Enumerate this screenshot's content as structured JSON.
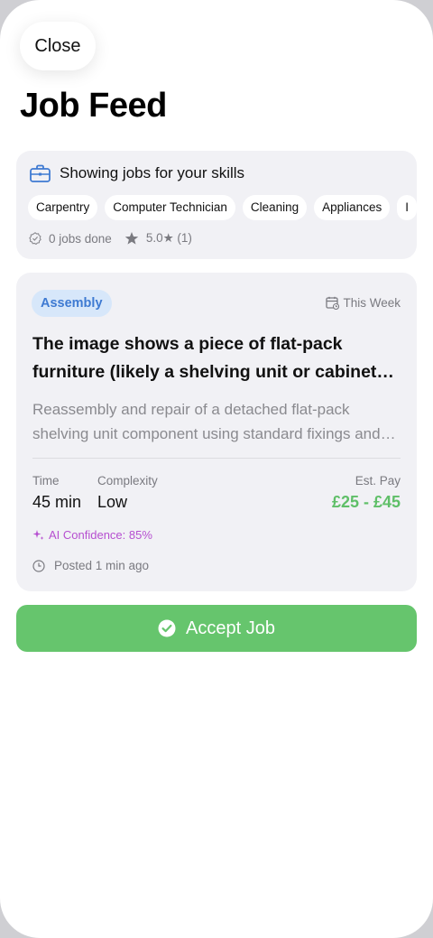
{
  "header": {
    "close_label": "Close",
    "title": "Job Feed"
  },
  "skills": {
    "icon": "briefcase-icon",
    "title": "Showing jobs for your skills",
    "chips": [
      "Carpentry",
      "Computer Technician",
      "Cleaning",
      "Appliances",
      "I"
    ],
    "jobs_done": "0 jobs done",
    "rating": "5.0★ (1)"
  },
  "job": {
    "category": "Assembly",
    "schedule": "This Week",
    "title": "The image shows a piece of flat-pack furniture (likely a shelving unit or cabinet component)",
    "description": "Reassembly and repair of a detached flat-pack shelving unit component using standard fixings and adhesive",
    "time_label": "Time",
    "time_value": "45 min",
    "complexity_label": "Complexity",
    "complexity_value": "Low",
    "pay_label": "Est. Pay",
    "pay_value": "£25 - £45",
    "ai_confidence": "AI Confidence: 85%",
    "posted": "Posted 1 min ago"
  },
  "actions": {
    "accept_label": "Accept Job"
  },
  "colors": {
    "accent_green": "#66c56d",
    "pay_green": "#5fbf68",
    "badge_blue": "#3e7ad2",
    "ai_purple": "#b64fd0"
  }
}
